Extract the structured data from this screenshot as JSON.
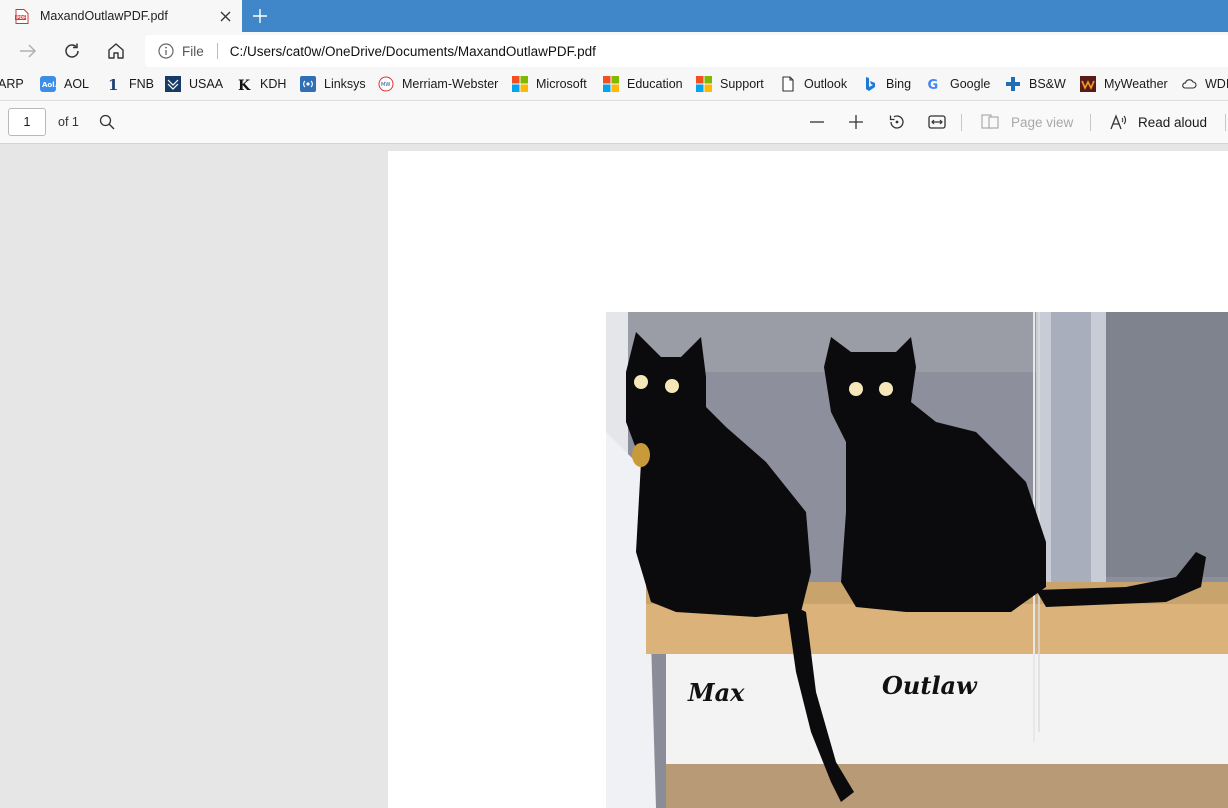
{
  "tab": {
    "title": "MaxandOutlawPDF.pdf"
  },
  "address": {
    "scheme": "File",
    "url": "C:/Users/cat0w/OneDrive/Documents/MaxandOutlawPDF.pdf"
  },
  "bookmarks": [
    {
      "label": "ARP",
      "icon": "aarp-icon"
    },
    {
      "label": "AOL",
      "icon": "aol-icon"
    },
    {
      "label": "FNB",
      "icon": "fnb-icon"
    },
    {
      "label": "USAA",
      "icon": "usaa-icon"
    },
    {
      "label": "KDH",
      "icon": "kdh-icon"
    },
    {
      "label": "Linksys",
      "icon": "linksys-icon"
    },
    {
      "label": "Merriam-Webster",
      "icon": "merriam-webster-icon"
    },
    {
      "label": "Microsoft",
      "icon": "microsoft-icon"
    },
    {
      "label": "Education",
      "icon": "microsoft-icon"
    },
    {
      "label": "Support",
      "icon": "microsoft-icon"
    },
    {
      "label": "Outlook",
      "icon": "page-icon"
    },
    {
      "label": "Bing",
      "icon": "bing-icon"
    },
    {
      "label": "Google",
      "icon": "google-icon"
    },
    {
      "label": "BS&W",
      "icon": "bsw-icon"
    },
    {
      "label": "MyWeather",
      "icon": "myweather-icon"
    },
    {
      "label": "WDI",
      "icon": "cloud-icon"
    }
  ],
  "pdf_toolbar": {
    "page_number": "1",
    "page_count": "of 1",
    "page_view_label": "Page view",
    "read_aloud_label": "Read aloud"
  },
  "document": {
    "caption_left": "Max",
    "caption_right": "Outlaw"
  },
  "colors": {
    "titlebar": "#3f87c9",
    "tab_background": "#f7f7f7",
    "viewer_background": "#e6e6e6",
    "page_background": "#ffffff"
  }
}
